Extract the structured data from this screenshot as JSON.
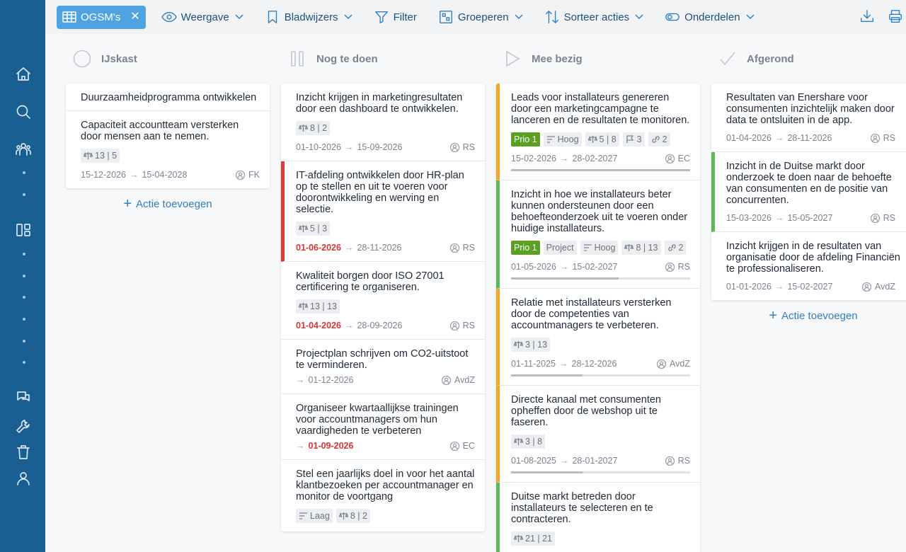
{
  "toolbar": {
    "chip_label": "OGSM's",
    "items": [
      "Weergave",
      "Bladwijzers",
      "Filter",
      "Groeperen",
      "Sorteer acties",
      "Onderdelen"
    ]
  },
  "colors": {
    "sidebar": "#1a5f92",
    "accent": "#2f7fc1",
    "prio": "#5aa021",
    "overdue": "#e03a3a"
  },
  "add_action_label": "Actie toevoegen",
  "columns": [
    {
      "title": "IJskast",
      "cards": [
        {
          "title": "Duurzaamheidprogramma ontwikkelen"
        },
        {
          "title": "Capaciteit accountteam versterken door mensen aan te nemen.",
          "tags": [
            "13 | 5"
          ],
          "start": "15-12-2026",
          "end": "15-04-2028",
          "owner": "FK"
        }
      ]
    },
    {
      "title": "Nog te doen",
      "cards": [
        {
          "title": "Inzicht krijgen in marketingresultaten door een dashboard te ontwikkelen.",
          "tags": [
            "8 | 2"
          ],
          "start": "01-10-2026",
          "end": "15-09-2026",
          "owner": "RS"
        },
        {
          "title": "IT-afdeling ontwikkelen door HR-plan op te stellen en uit te voeren voor doorontwikkeling en werving en selectie.",
          "tags": [
            "5 | 3"
          ],
          "start": "01-06-2026",
          "end": "28-11-2026",
          "owner": "RS"
        },
        {
          "title": "Kwaliteit borgen door ISO 27001 certificering te organiseren.",
          "tags": [
            "13 | 13"
          ],
          "start": "01-04-2026",
          "end": "28-09-2026",
          "owner": "RS"
        },
        {
          "title": "Projectplan schrijven om CO2-uitstoot te verminderen.",
          "end": "01-12-2026",
          "owner": "AvdZ"
        },
        {
          "title": "Organiseer kwartaallijkse trainingen voor accountmanagers om hun vaardigheden te verbeteren",
          "end": "01-09-2026",
          "owner": "EC"
        },
        {
          "title": "Stel een jaarlijks doel in voor het aantal klantbezoeken per accountmanager en monitor de voortgang",
          "priority": "Laag",
          "tags": [
            "8 | 2"
          ]
        }
      ]
    },
    {
      "title": "Mee bezig",
      "cards": [
        {
          "title": "Leads voor installateurs genereren door een marketingcampagne te lanceren en de resultaten te monitoren.",
          "prio": "Prio 1",
          "priority": "Hoog",
          "tags": [
            "5 | 8"
          ],
          "flag": "3",
          "links": "2",
          "start": "15-02-2026",
          "end": "28-02-2027",
          "owner": "EC",
          "progress": 1.0
        },
        {
          "title": "Inzicht in hoe we installateurs beter kunnen ondersteunen door een behoefteonderzoek uit te voeren onder huidige installateurs.",
          "prio": "Prio 1",
          "type": "Project",
          "priority": "Hoog",
          "tags": [
            "8 | 13"
          ],
          "links": "2",
          "start": "01-05-2026",
          "end": "15-02-2027",
          "owner": "RS",
          "progress": 0.6
        },
        {
          "title": "Relatie met installateurs versterken door de competenties van accountmanagers te verbeteren.",
          "tags": [
            "3 | 13"
          ],
          "start": "01-11-2025",
          "end": "28-12-2026",
          "owner": "AvdZ",
          "progress": 0.4
        },
        {
          "title": "Directe kanaal met consumenten opheffen door de webshop uit te faseren.",
          "tags": [
            "3 | 8"
          ],
          "start": "01-08-2025",
          "end": "28-01-2027",
          "owner": "RS",
          "progress": 0.4
        },
        {
          "title": "Duitse markt betreden door installateurs te selecteren en te contracteren.",
          "tags": [
            "21 | 21"
          ]
        }
      ]
    },
    {
      "title": "Afgerond",
      "cards": [
        {
          "title": "Resultaten van Enershare voor consumenten inzichtelijk maken door data te ontsluiten in de app.",
          "start": "01-04-2026",
          "end": "28-11-2026",
          "owner": "RS"
        },
        {
          "title": "Inzicht in de Duitse markt door onderzoek te doen naar de behoefte van consumenten en de positie van concurrenten.",
          "start": "15-03-2026",
          "end": "15-05-2027",
          "owner": "RS"
        },
        {
          "title": "Inzicht krijgen in de resultaten van organisatie door de afdeling Financiën te professionaliseren.",
          "start": "01-01-2026",
          "end": "15-02-2027",
          "owner": "AvdZ"
        }
      ]
    }
  ]
}
